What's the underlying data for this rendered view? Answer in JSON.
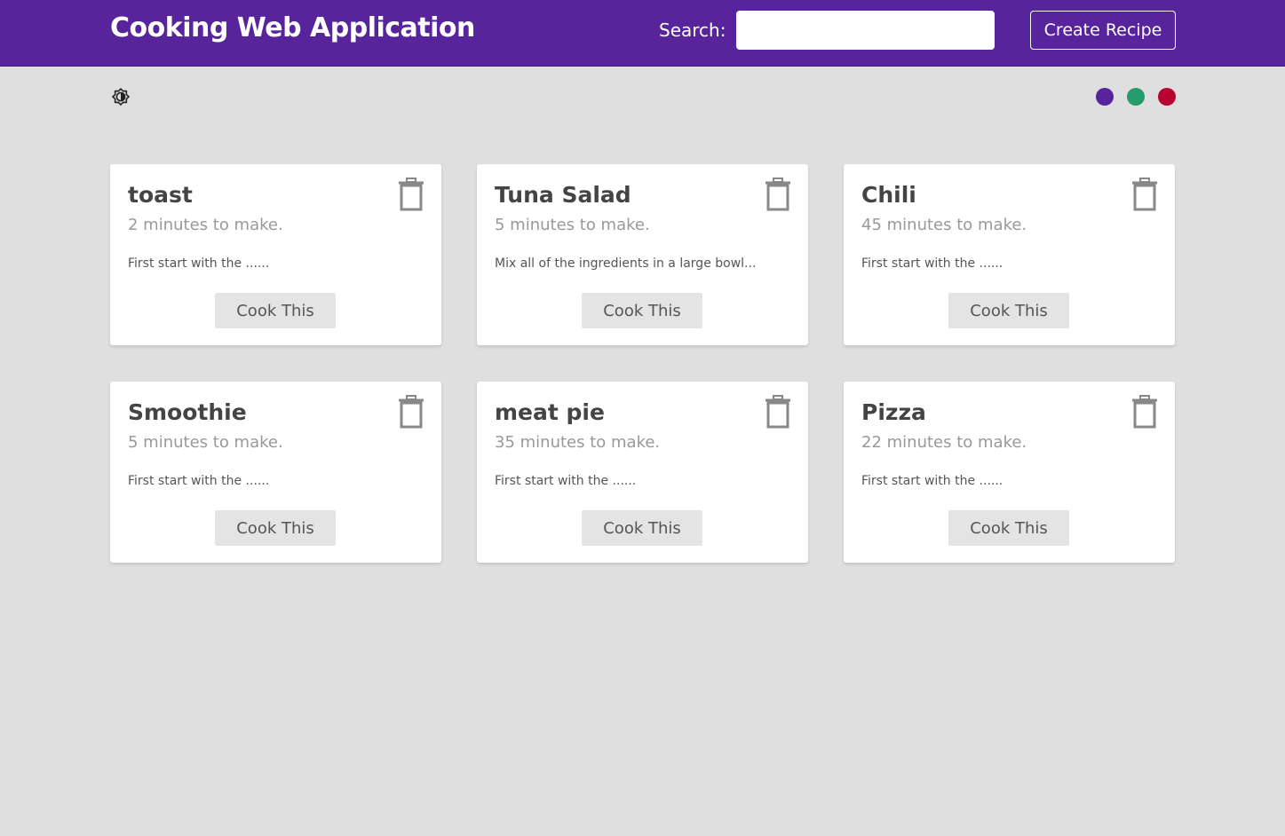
{
  "header": {
    "title": "Cooking Web Application",
    "search_label": "Search:",
    "search_value": "",
    "search_placeholder": "",
    "create_label": "Create Recipe",
    "background_color": "#58249c"
  },
  "controls": {
    "mode_toggle_icon": "brightness-toggle-icon",
    "theme_colors": [
      "#58249c",
      "#249c6b",
      "#b70233"
    ]
  },
  "recipes": [
    {
      "title": "toast",
      "time": "2 minutes to make.",
      "method": "First start with the ......",
      "button": "Cook This"
    },
    {
      "title": "Tuna Salad",
      "time": "5 minutes to make.",
      "method": "Mix all of the ingredients in a large bowl...",
      "button": "Cook This"
    },
    {
      "title": "Chili",
      "time": "45 minutes to make.",
      "method": "First start with the ......",
      "button": "Cook This"
    },
    {
      "title": "Smoothie",
      "time": "5 minutes to make.",
      "method": "First start with the ......",
      "button": "Cook This"
    },
    {
      "title": "meat pie",
      "time": "35 minutes to make.",
      "method": "First start with the ......",
      "button": "Cook This"
    },
    {
      "title": "Pizza",
      "time": "22 minutes to make.",
      "method": "First start with the ......",
      "button": "Cook This"
    }
  ]
}
